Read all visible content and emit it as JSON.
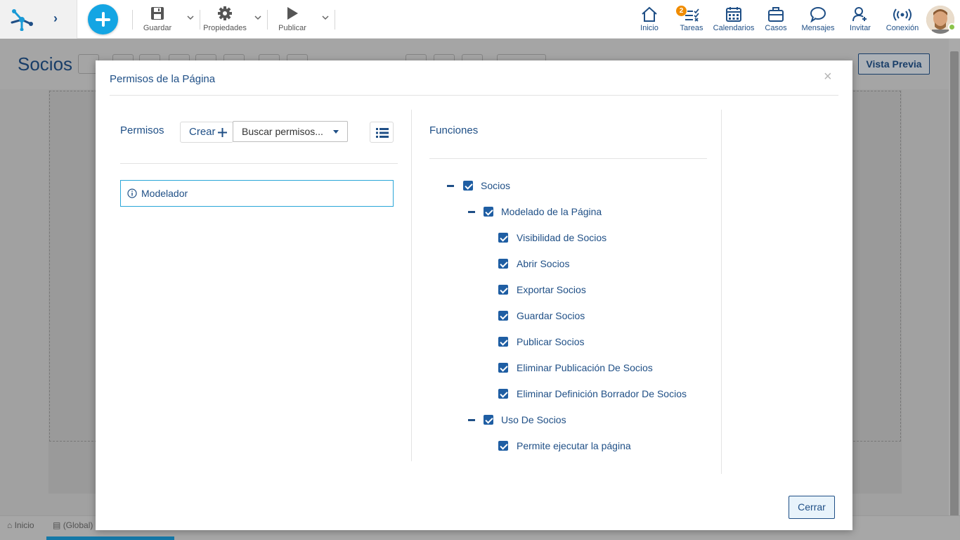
{
  "toolbar": {
    "guardar": "Guardar",
    "propiedades": "Propiedades",
    "publicar": "Publicar"
  },
  "nav": {
    "inicio": "Inicio",
    "tareas": "Tareas",
    "tareas_badge": "2",
    "calendarios": "Calendarios",
    "casos": "Casos",
    "mensajes": "Mensajes",
    "invitar": "Invitar",
    "conexion": "Conexión"
  },
  "page": {
    "title": "Socios",
    "vista_previa": "Vista Previa"
  },
  "bottom": {
    "inicio": "Inicio",
    "global": "(Global)"
  },
  "modal": {
    "title": "Permisos de la Página",
    "close": "×",
    "permisos_label": "Permisos",
    "crear_label": "Crear",
    "search_value": "Buscar permisos...",
    "permissions": [
      {
        "name": "Modelador"
      }
    ],
    "funciones_label": "Funciones",
    "tree": [
      {
        "label": "Socios",
        "checked": true,
        "level": 0,
        "collapsible": true
      },
      {
        "label": "Modelado de la Página",
        "checked": true,
        "level": 1,
        "collapsible": true
      },
      {
        "label": "Visibilidad de Socios",
        "checked": true,
        "level": 2,
        "collapsible": false
      },
      {
        "label": "Abrir Socios",
        "checked": true,
        "level": 2,
        "collapsible": false
      },
      {
        "label": "Exportar Socios",
        "checked": true,
        "level": 2,
        "collapsible": false
      },
      {
        "label": "Guardar Socios",
        "checked": true,
        "level": 2,
        "collapsible": false
      },
      {
        "label": "Publicar Socios",
        "checked": true,
        "level": 2,
        "collapsible": false
      },
      {
        "label": "Eliminar Publicación De Socios",
        "checked": true,
        "level": 2,
        "collapsible": false
      },
      {
        "label": "Eliminar Definición Borrador De Socios",
        "checked": true,
        "level": 2,
        "collapsible": false
      },
      {
        "label": "Uso De Socios",
        "checked": true,
        "level": 1,
        "collapsible": true
      },
      {
        "label": "Permite ejecutar la página",
        "checked": true,
        "level": 2,
        "collapsible": false
      }
    ],
    "cerrar_label": "Cerrar"
  },
  "colors": {
    "accent": "#14a5e3",
    "primary_text": "#1f4f86",
    "checkbox": "#1f5ea3",
    "badge": "#f08c00",
    "online": "#8bc34a"
  }
}
